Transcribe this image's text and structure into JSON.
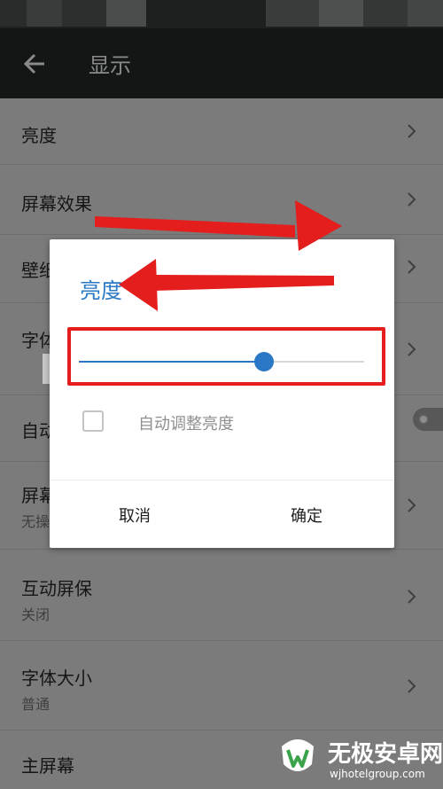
{
  "app_bar": {
    "title": "显示"
  },
  "settings": {
    "items": [
      {
        "label": "亮度"
      },
      {
        "label": "屏幕效果"
      },
      {
        "label": "壁纸"
      },
      {
        "label": "字体"
      },
      {
        "label": "自动"
      },
      {
        "label": "屏幕",
        "sub": "无操"
      },
      {
        "label": "互动屏保",
        "sub": "关闭"
      },
      {
        "label": "字体大小",
        "sub": "普通"
      },
      {
        "label": "主屏幕"
      }
    ]
  },
  "dialog": {
    "title": "亮度",
    "slider_value_fraction": 0.65,
    "auto_brightness_label": "自动调整亮度",
    "auto_brightness_checked": false,
    "cancel_label": "取消",
    "ok_label": "确定"
  },
  "watermark": {
    "title": "无极安卓网",
    "url": "wjhotelgroup.com"
  },
  "colors": {
    "accent_blue": "#2a78c5",
    "annotation_red": "#e41d1d",
    "overlay_gray": "#7b7b7b",
    "app_bar": "#141615"
  },
  "icons": {
    "back": "back-arrow-icon",
    "chevron": "chevron-right-icon",
    "logo": "watermark-logo-icon"
  }
}
